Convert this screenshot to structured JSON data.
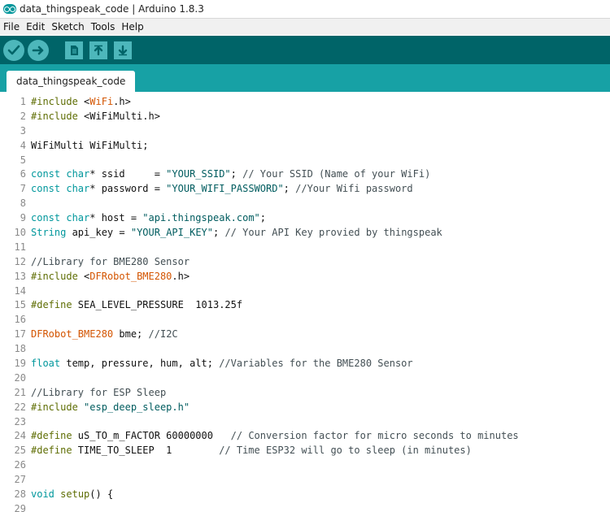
{
  "window": {
    "title": "data_thingspeak_code | Arduino 1.8.3"
  },
  "menu": [
    "File",
    "Edit",
    "Sketch",
    "Tools",
    "Help"
  ],
  "toolbar": {
    "buttons": [
      {
        "name": "verify-button",
        "icon": "check-icon"
      },
      {
        "name": "upload-button",
        "icon": "arrow-right-icon"
      },
      {
        "name": "new-button",
        "icon": "new-file-icon"
      },
      {
        "name": "open-button",
        "icon": "arrow-up-icon"
      },
      {
        "name": "save-button",
        "icon": "arrow-down-icon"
      }
    ]
  },
  "tabs": [
    {
      "label": "data_thingspeak_code"
    }
  ],
  "code": [
    {
      "n": "1",
      "parts": [
        [
          "kw",
          "#include "
        ],
        [
          "txt",
          "<"
        ],
        [
          "lib",
          "WiFi"
        ],
        [
          "txt",
          ".h>"
        ]
      ]
    },
    {
      "n": "2",
      "parts": [
        [
          "kw",
          "#include "
        ],
        [
          "txt",
          "<WiFiMulti.h>"
        ]
      ]
    },
    {
      "n": "3",
      "parts": []
    },
    {
      "n": "4",
      "parts": [
        [
          "txt",
          "WiFiMulti WiFiMulti;"
        ]
      ]
    },
    {
      "n": "5",
      "parts": []
    },
    {
      "n": "6",
      "parts": [
        [
          "ty",
          "const char"
        ],
        [
          "txt",
          "* ssid     = "
        ],
        [
          "st",
          "\"YOUR_SSID\""
        ],
        [
          "txt",
          "; "
        ],
        [
          "cm",
          "// Your SSID (Name of your WiFi)"
        ]
      ]
    },
    {
      "n": "7",
      "parts": [
        [
          "ty",
          "const char"
        ],
        [
          "txt",
          "* password = "
        ],
        [
          "st",
          "\"YOUR_WIFI_PASSWORD\""
        ],
        [
          "txt",
          "; "
        ],
        [
          "cm",
          "//Your Wifi password"
        ]
      ]
    },
    {
      "n": "8",
      "parts": []
    },
    {
      "n": "9",
      "parts": [
        [
          "ty",
          "const char"
        ],
        [
          "txt",
          "* host = "
        ],
        [
          "st",
          "\"api.thingspeak.com\""
        ],
        [
          "txt",
          ";"
        ]
      ]
    },
    {
      "n": "10",
      "parts": [
        [
          "ty",
          "String"
        ],
        [
          "txt",
          " api_key = "
        ],
        [
          "st",
          "\"YOUR_API_KEY\""
        ],
        [
          "txt",
          "; "
        ],
        [
          "cm",
          "// Your API Key provied by thingspeak"
        ]
      ]
    },
    {
      "n": "11",
      "parts": []
    },
    {
      "n": "12",
      "parts": [
        [
          "cm",
          "//Library for BME280 Sensor"
        ]
      ]
    },
    {
      "n": "13",
      "parts": [
        [
          "kw",
          "#include "
        ],
        [
          "txt",
          "<"
        ],
        [
          "lib",
          "DFRobot_BME280"
        ],
        [
          "txt",
          ".h>"
        ]
      ]
    },
    {
      "n": "14",
      "parts": []
    },
    {
      "n": "15",
      "parts": [
        [
          "kw",
          "#define "
        ],
        [
          "txt",
          "SEA_LEVEL_PRESSURE  1013.25f"
        ]
      ]
    },
    {
      "n": "16",
      "parts": []
    },
    {
      "n": "17",
      "parts": [
        [
          "lib",
          "DFRobot_BME280"
        ],
        [
          "txt",
          " bme; "
        ],
        [
          "cm",
          "//I2C"
        ]
      ]
    },
    {
      "n": "18",
      "parts": []
    },
    {
      "n": "19",
      "parts": [
        [
          "ty",
          "float"
        ],
        [
          "txt",
          " temp, pressure, hum, alt; "
        ],
        [
          "cm",
          "//Variables for the BME280 Sensor"
        ]
      ]
    },
    {
      "n": "20",
      "parts": []
    },
    {
      "n": "21",
      "parts": [
        [
          "cm",
          "//Library for ESP Sleep"
        ]
      ]
    },
    {
      "n": "22",
      "parts": [
        [
          "kw",
          "#include "
        ],
        [
          "st",
          "\"esp_deep_sleep.h\""
        ]
      ]
    },
    {
      "n": "23",
      "parts": []
    },
    {
      "n": "24",
      "parts": [
        [
          "kw",
          "#define "
        ],
        [
          "txt",
          "uS_TO_m_FACTOR 60000000   "
        ],
        [
          "cm",
          "// Conversion factor for micro seconds to minutes"
        ]
      ]
    },
    {
      "n": "25",
      "parts": [
        [
          "kw",
          "#define "
        ],
        [
          "txt",
          "TIME_TO_SLEEP  1        "
        ],
        [
          "cm",
          "// Time ESP32 will go to sleep (in minutes)"
        ]
      ]
    },
    {
      "n": "26",
      "parts": []
    },
    {
      "n": "27",
      "parts": []
    },
    {
      "n": "28",
      "parts": [
        [
          "ty",
          "void"
        ],
        [
          "txt",
          " "
        ],
        [
          "kw",
          "setup"
        ],
        [
          "txt",
          "() {"
        ]
      ]
    },
    {
      "n": "29",
      "parts": []
    }
  ]
}
